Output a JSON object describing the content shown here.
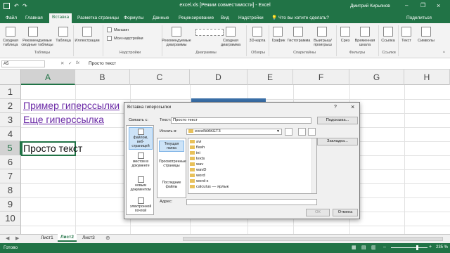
{
  "title_bar": {
    "autosave": "Файл",
    "title": "excel.xls [Режим совместимости] - Excel",
    "user": "Дмитрий Кирьянов"
  },
  "tabs": [
    {
      "label": "Файл"
    },
    {
      "label": "Главная"
    },
    {
      "label": "Вставка",
      "active": true
    },
    {
      "label": "Разметка страницы"
    },
    {
      "label": "Формулы"
    },
    {
      "label": "Данные"
    },
    {
      "label": "Рецензирование"
    },
    {
      "label": "Вид"
    },
    {
      "label": "Надстройки"
    },
    {
      "label": "Что вы хотите сделать?"
    },
    {
      "label": "Поделиться"
    }
  ],
  "ribbon": {
    "buttons": [
      "Сводная таблица",
      "Рекомендуемые сводные таблицы",
      "Таблица",
      "Иллюстрации",
      "Магазин",
      "Мои надстройки",
      "Рекомендуемые диаграммы",
      "Сводная диаграмма",
      "3D-карта",
      "График",
      "Гистограмма",
      "Выигрыш/проигрыш",
      "Срез",
      "Временная шкала",
      "Ссылка",
      "Текст",
      "Символы"
    ],
    "groups": [
      "Таблицы",
      "Надстройки",
      "Диаграммы",
      "Обзоры",
      "Спарклайны",
      "Фильтры",
      "Ссылки"
    ]
  },
  "formula_bar": {
    "name_box": "A5",
    "content": "Просто текст"
  },
  "columns": [
    "A",
    "B",
    "C",
    "D",
    "E",
    "F",
    "G",
    "H"
  ],
  "rows": [
    "1",
    "2",
    "3",
    "4",
    "5",
    "6",
    "7",
    "8",
    "9",
    "10"
  ],
  "cells": {
    "a2": "Пример гиперссылки",
    "a3": "Еще гиперссылка",
    "a5": "Просто текст"
  },
  "dialog": {
    "title": "Вставка гиперссылки",
    "help": "?",
    "close": "×",
    "link_to": "Связать с:",
    "text_label": "Текст:",
    "text_value": "Просто текст",
    "tooltip_btn": "Подсказка...",
    "look_in_label": "Искать в:",
    "look_in_value": "excelMAKET3",
    "bookmark_btn": "Закладка...",
    "nav": [
      {
        "label": "файлом, веб-страницей"
      },
      {
        "label": "местом в документе"
      },
      {
        "label": "новым документом"
      },
      {
        "label": "электронной почтой"
      }
    ],
    "sub_nav": [
      {
        "label": "Текущая папка"
      },
      {
        "label": "Просмотренные страницы"
      },
      {
        "label": "Последние файлы"
      }
    ],
    "files": [
      "avi",
      "flash",
      "ini",
      "texts",
      "wav",
      "wavD",
      "word",
      "word-x",
      "calculus — ярлык"
    ],
    "address_label": "Адрес:",
    "address_value": "",
    "ok": "ОК",
    "cancel": "Отмена"
  },
  "sheet_tabs": [
    "Лист1",
    "Лист2",
    "Лист3"
  ],
  "status": {
    "left": "Готово",
    "zoom": "235 %"
  },
  "colors": {
    "accent": "#217346",
    "hyperlink": "#6b2aa6"
  }
}
